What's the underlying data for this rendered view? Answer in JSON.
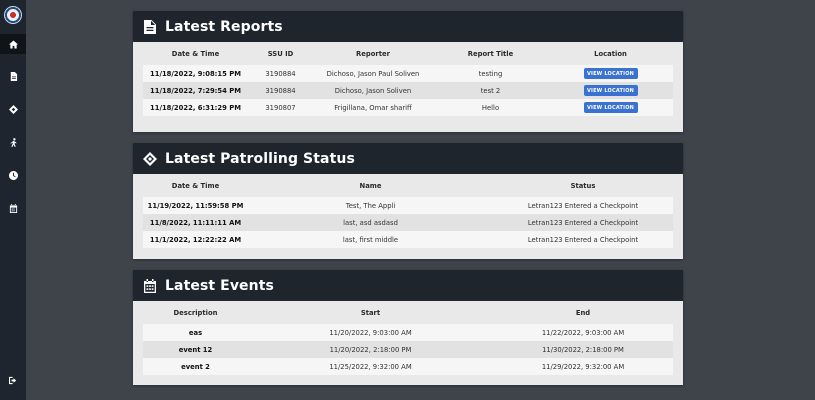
{
  "sidebar": {
    "items": [
      {
        "icon": "home-icon"
      },
      {
        "icon": "document-icon"
      },
      {
        "icon": "patrol-icon"
      },
      {
        "icon": "walking-icon"
      },
      {
        "icon": "clock-icon"
      },
      {
        "icon": "calendar-icon"
      }
    ],
    "logout_icon": "logout-icon"
  },
  "reports": {
    "title": "Latest Reports",
    "headers": [
      "Date & Time",
      "SSU ID",
      "Reporter",
      "Report Title",
      "Location"
    ],
    "rows": [
      {
        "datetime": "11/18/2022, 9:08:15 PM",
        "ssu_id": "3190884",
        "reporter": "Dichoso, Jason Paul Soliven",
        "title": "testing",
        "action": "VIEW LOCATION"
      },
      {
        "datetime": "11/18/2022, 7:29:54 PM",
        "ssu_id": "3190884",
        "reporter": "Dichoso, Jason Soliven",
        "title": "test 2",
        "action": "VIEW LOCATION"
      },
      {
        "datetime": "11/18/2022, 6:31:29 PM",
        "ssu_id": "3190807",
        "reporter": "Frigillana, Omar shariff",
        "title": "Hello",
        "action": "VIEW LOCATION"
      }
    ]
  },
  "patrolling": {
    "title": "Latest Patrolling Status",
    "headers": [
      "Date & Time",
      "Name",
      "Status"
    ],
    "rows": [
      {
        "datetime": "11/19/2022, 11:59:58 PM",
        "name": "Test, The Appli",
        "status": "Letran123 Entered a Checkpoint"
      },
      {
        "datetime": "11/8/2022, 11:11:11 AM",
        "name": "last, asd asdasd",
        "status": "Letran123 Entered a Checkpoint"
      },
      {
        "datetime": "11/1/2022, 12:22:22 AM",
        "name": "last, first middle",
        "status": "Letran123 Entered a Checkpoint"
      }
    ]
  },
  "events": {
    "title": "Latest Events",
    "headers": [
      "Description",
      "Start",
      "End"
    ],
    "rows": [
      {
        "description": "eas",
        "start": "11/20/2022, 9:03:00 AM",
        "end": "11/22/2022, 9:03:00 AM"
      },
      {
        "description": "event 12",
        "start": "11/20/2022, 2:18:00 PM",
        "end": "11/30/2022, 2:18:00 PM"
      },
      {
        "description": "event 2",
        "start": "11/25/2022, 9:32:00 AM",
        "end": "11/29/2022, 9:32:00 AM"
      }
    ]
  },
  "colors": {
    "header_bg": "#1f252d",
    "sidebar_bg": "#1e252e",
    "page_bg": "#3f444b",
    "button": "#3a72d1"
  }
}
